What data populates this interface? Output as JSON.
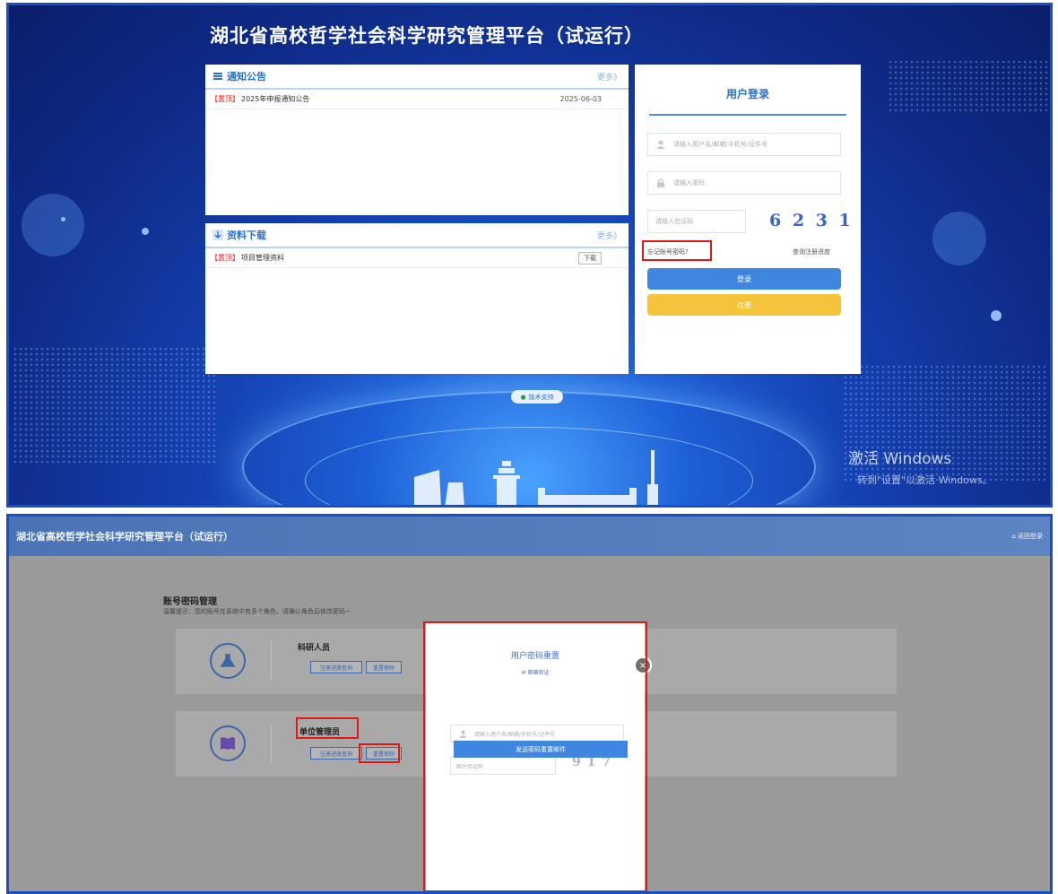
{
  "top": {
    "title": "湖北省高校哲学社会科学研究管理平台（试运行）",
    "notice": {
      "title": "通知公告",
      "more": "更多》",
      "items": [
        {
          "tag": "【置顶】",
          "text": "2025年申报通知公告",
          "date": "2025-06-03"
        }
      ]
    },
    "download": {
      "title": "资料下载",
      "more": "更多》",
      "items": [
        {
          "tag": "【置顶】",
          "text": "项目管理资料",
          "button": "下载"
        }
      ]
    },
    "login": {
      "title": "用户登录",
      "username_placeholder": "请输入用户名/邮箱/手机号/证件号",
      "password_placeholder": "请输入密码",
      "captcha_placeholder": "请输入验证码",
      "captcha_image_text": "6 2 3 1",
      "forgot": "忘记账号密码?",
      "query_progress": "查询注册进度",
      "login_button": "登录",
      "register_button": "注册"
    },
    "support": "技术支持",
    "windows_watermark_1": "激活 Windows",
    "windows_watermark_2": "转到\"设置\"以激活 Windows。",
    "colors": {
      "login_button": "#3f86e0",
      "register_button": "#f6c43a",
      "highlight": "#e01818"
    }
  },
  "bottom": {
    "header_title": "湖北省高校哲学社会科学研究管理平台（试运行）",
    "back_link": "返回登录",
    "section_title": "账号密码管理",
    "hint": "温馨提示：您的账号在系统中有多个角色，请确认角色后修改密码~",
    "roles": [
      {
        "name": "科研人员",
        "icon": "flask-icon",
        "buttons": [
          "注册进度查询",
          "重置密码"
        ]
      },
      {
        "name": "单位管理员",
        "icon": "book-icon",
        "buttons": [
          "注册进度查询",
          "重置密码"
        ]
      }
    ],
    "modal": {
      "title": "用户密码重置",
      "method": "邮箱验证",
      "username_placeholder": "请输入用户名/邮箱/手机号/证件号",
      "captcha_placeholder": "图片验证码",
      "captcha_image_text": "9 1 7",
      "submit": "发送密码重置邮件",
      "close": "×"
    }
  }
}
